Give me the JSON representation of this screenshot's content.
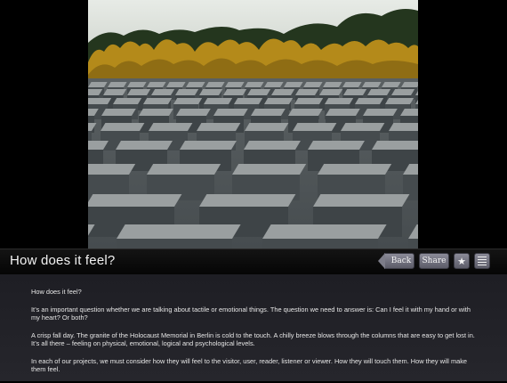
{
  "header": {
    "title": "How does it feel?",
    "buttons": {
      "back": "Back",
      "share": "Share",
      "favorite_icon": "star-icon",
      "menu_icon": "menu-icon"
    }
  },
  "article": {
    "paragraphs": [
      "How does it feel?",
      "It’s an important question whether we are talking about tactile or emotional things. The question we need to answer is: Can I feel it with my hand or with my heart? Or both?",
      "A crisp fall day. The granite of the Holocaust Memorial in Berlin is cold to the touch. A chilly breeze blows through the columns that are easy to get lost in. It’s all there – feeling on physical, emotional, logical and psychological levels.",
      "In each of our projects, we must consider how they will feel to the visitor, user, reader, listener or viewer. How they will touch them. How they will make them feel."
    ]
  },
  "colors": {
    "background": "#000000",
    "toolbar": "#0b0b0b",
    "content_bg": "#232329",
    "button": "#74747f",
    "text": "#e6e6e6"
  }
}
